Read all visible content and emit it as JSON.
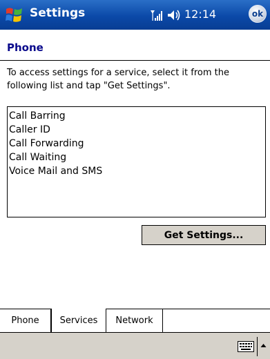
{
  "titlebar": {
    "title": "Settings",
    "time": "12:14",
    "ok_label": "ok"
  },
  "page": {
    "heading": "Phone",
    "instructions": "To access settings for a service, select it from the following list and tap \"Get Settings\"."
  },
  "services": [
    "Call Barring",
    "Caller ID",
    "Call Forwarding",
    "Call Waiting",
    "Voice Mail and SMS"
  ],
  "get_settings_label": "Get Settings...",
  "tabs": [
    {
      "label": "Phone",
      "active": false
    },
    {
      "label": "Services",
      "active": true
    },
    {
      "label": "Network",
      "active": false
    }
  ],
  "icons": {
    "start": "windows-flag-icon",
    "signal": "signal-icon",
    "volume": "volume-icon",
    "keyboard": "keyboard-icon",
    "sip": "up-arrow-icon"
  },
  "colors": {
    "titlebar": "#0b49a8",
    "heading": "#0a0a8c",
    "button": "#d6d2ca"
  }
}
